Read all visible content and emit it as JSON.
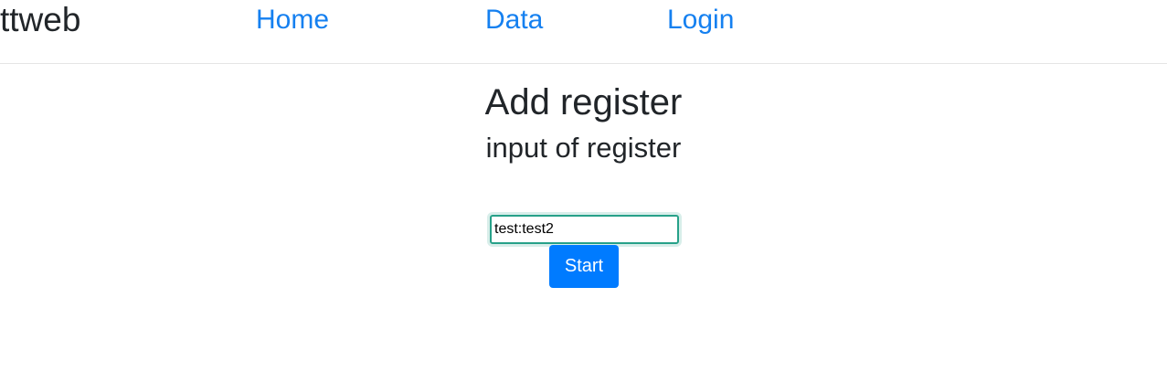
{
  "navbar": {
    "brand": "ttweb",
    "links": [
      {
        "label": "Home"
      },
      {
        "label": "Data"
      },
      {
        "label": "Login"
      }
    ]
  },
  "main": {
    "title": "Add register",
    "subtitle": "input of register",
    "input": {
      "value": "test:test2"
    },
    "start_label": "Start"
  },
  "colors": {
    "link": "#1580f0",
    "button": "#007bff",
    "input_focus_border": "#27a189",
    "text": "#212529"
  }
}
